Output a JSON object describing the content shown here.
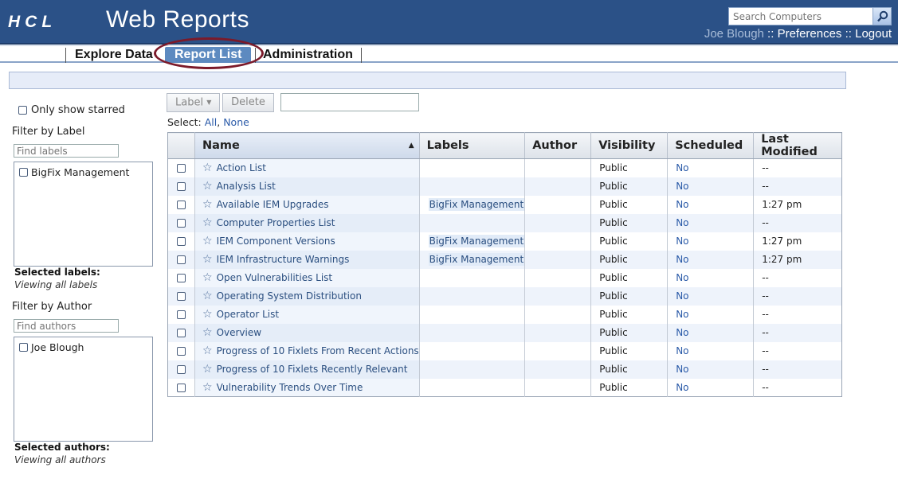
{
  "header": {
    "logo_text": "HCL",
    "title": "Web Reports",
    "search_placeholder": "Search Computers",
    "user": "Joe Blough",
    "separator": " :: ",
    "preferences": "Preferences",
    "logout": "Logout"
  },
  "nav": {
    "tabs": [
      {
        "label": "Explore Data"
      },
      {
        "label": "Report List"
      },
      {
        "label": "Administration"
      }
    ]
  },
  "sidebar": {
    "only_starred": "Only show starred",
    "filter_label_heading": "Filter by Label",
    "find_labels_placeholder": "Find labels",
    "labels": [
      "BigFix Management"
    ],
    "selected_labels_title": "Selected labels:",
    "selected_labels_value": "Viewing all labels",
    "filter_author_heading": "Filter by Author",
    "find_authors_placeholder": "Find authors",
    "authors": [
      "Joe Blough"
    ],
    "selected_authors_title": "Selected authors:",
    "selected_authors_value": "Viewing all authors"
  },
  "toolbar": {
    "label_button": "Label",
    "delete_button": "Delete",
    "select_prefix": "Select: ",
    "select_all": "All",
    "select_sep": ", ",
    "select_none": "None"
  },
  "table": {
    "columns": [
      "Name",
      "Labels",
      "Author",
      "Visibility",
      "Scheduled",
      "Last Modified"
    ],
    "rows": [
      {
        "name": "Action List",
        "label": "",
        "author": "",
        "visibility": "Public",
        "scheduled": "No",
        "modified": "--"
      },
      {
        "name": "Analysis List",
        "label": "",
        "author": "",
        "visibility": "Public",
        "scheduled": "No",
        "modified": "--"
      },
      {
        "name": "Available IEM Upgrades",
        "label": "BigFix Management",
        "author": "",
        "visibility": "Public",
        "scheduled": "No",
        "modified": "1:27 pm"
      },
      {
        "name": "Computer Properties List",
        "label": "",
        "author": "",
        "visibility": "Public",
        "scheduled": "No",
        "modified": "--"
      },
      {
        "name": "IEM Component Versions",
        "label": "BigFix Management",
        "author": "",
        "visibility": "Public",
        "scheduled": "No",
        "modified": "1:27 pm"
      },
      {
        "name": "IEM Infrastructure Warnings",
        "label": "BigFix Management",
        "author": "",
        "visibility": "Public",
        "scheduled": "No",
        "modified": "1:27 pm"
      },
      {
        "name": "Open Vulnerabilities List",
        "label": "",
        "author": "",
        "visibility": "Public",
        "scheduled": "No",
        "modified": "--"
      },
      {
        "name": "Operating System Distribution",
        "label": "",
        "author": "",
        "visibility": "Public",
        "scheduled": "No",
        "modified": "--"
      },
      {
        "name": "Operator List",
        "label": "",
        "author": "",
        "visibility": "Public",
        "scheduled": "No",
        "modified": "--"
      },
      {
        "name": "Overview",
        "label": "",
        "author": "",
        "visibility": "Public",
        "scheduled": "No",
        "modified": "--"
      },
      {
        "name": "Progress of 10 Fixlets From Recent Actions",
        "label": "",
        "author": "",
        "visibility": "Public",
        "scheduled": "No",
        "modified": "--"
      },
      {
        "name": "Progress of 10 Fixlets Recently Relevant",
        "label": "",
        "author": "",
        "visibility": "Public",
        "scheduled": "No",
        "modified": "--"
      },
      {
        "name": "Vulnerability Trends Over Time",
        "label": "",
        "author": "",
        "visibility": "Public",
        "scheduled": "No",
        "modified": "--"
      }
    ]
  },
  "colors": {
    "header_bg": "#2b5187",
    "active_tab": "#5d8ac0",
    "highlight_ring": "#7b1a2a"
  }
}
